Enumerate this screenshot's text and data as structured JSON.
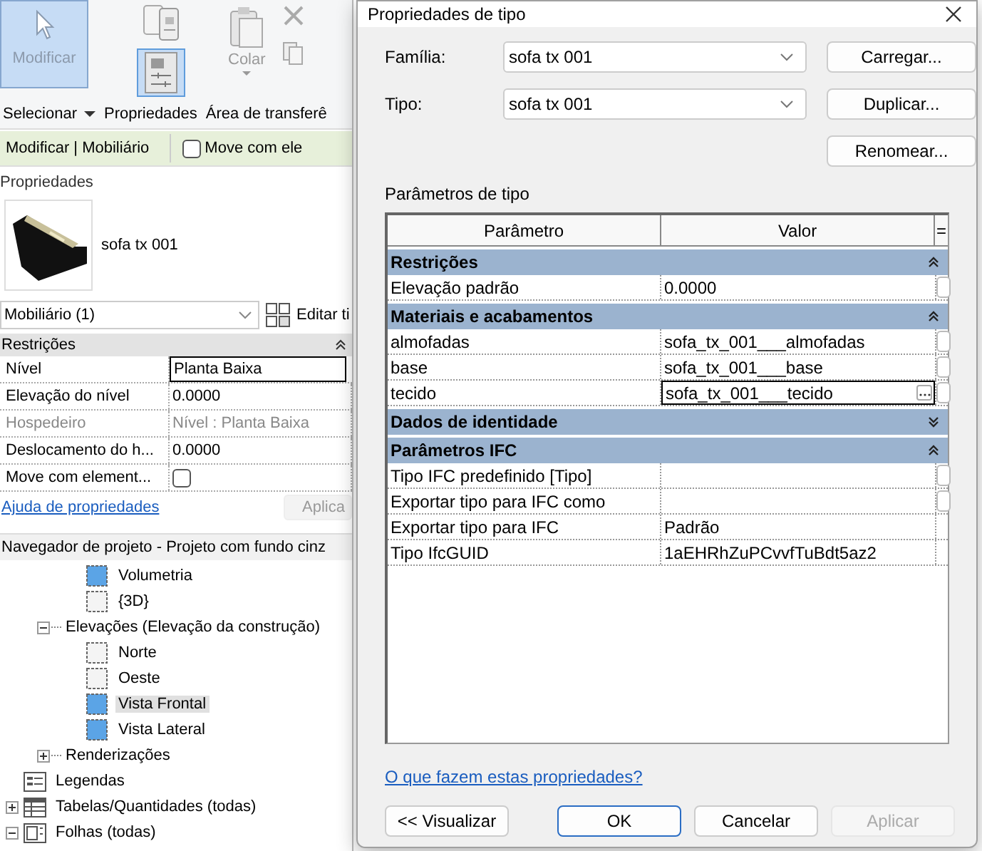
{
  "ribbon": {
    "modify": {
      "label": "Modificar",
      "selected": true
    },
    "properties_tool": {
      "selected": true
    },
    "paste": {
      "label": "Colar",
      "disabled": true
    },
    "panel_titles": [
      {
        "label": "Selecionar",
        "dropdown": true
      },
      {
        "label": "Propriedades",
        "dropdown": false
      },
      {
        "label": "Área de transferê",
        "dropdown": false
      }
    ]
  },
  "context_bar": {
    "title": "Modificar | Mobiliário",
    "option": {
      "label": "Move com ele",
      "checked": false
    }
  },
  "properties": {
    "title": "Propriedades",
    "type_name": "sofa tx 001",
    "selector": "Mobiliário (1)",
    "edit_type": "Editar ti",
    "groups": [
      {
        "name": "Restrições",
        "expanded": true,
        "rows": [
          {
            "name": "Nível",
            "kind": "text",
            "value": "Planta Baixa",
            "selected": true,
            "disabled": false
          },
          {
            "name": "Elevação do nível",
            "kind": "text",
            "value": "0.0000",
            "selected": false,
            "disabled": false
          },
          {
            "name": "Hospedeiro",
            "kind": "text",
            "value": "Nível : Planta Baixa",
            "selected": false,
            "disabled": true
          },
          {
            "name": "Deslocamento do h...",
            "kind": "text",
            "value": "0.0000",
            "selected": false,
            "disabled": false
          },
          {
            "name": "Move com element...",
            "kind": "checkbox",
            "checked": false,
            "selected": false,
            "disabled": false
          }
        ]
      }
    ],
    "help_link": "Ajuda de propriedades",
    "apply": {
      "label": "Aplica",
      "disabled": true
    }
  },
  "browser": {
    "title": "Navegador de projeto - Projeto com fundo cinz",
    "items": [
      {
        "children": [
          {
            "children": [
              {
                "label": "Volumetria",
                "kind": "view",
                "open": true,
                "selected": false
              },
              {
                "label": "{3D}",
                "kind": "view",
                "open": false,
                "selected": false
              }
            ]
          },
          {
            "label": "Elevações (Elevação da construção)",
            "kind": "category",
            "expanded": true,
            "selected": false,
            "children": [
              {
                "label": "Norte",
                "kind": "view",
                "open": false,
                "selected": false
              },
              {
                "label": "Oeste",
                "kind": "view",
                "open": false,
                "selected": false
              },
              {
                "label": "Vista Frontal",
                "kind": "view",
                "open": true,
                "selected": true
              },
              {
                "label": "Vista Lateral",
                "kind": "view",
                "open": true,
                "selected": false
              }
            ]
          },
          {
            "label": "Renderizações",
            "kind": "category",
            "expanded": false,
            "selected": false
          }
        ]
      },
      {
        "label": "Legendas",
        "kind": "legend",
        "selected": false
      },
      {
        "label": "Tabelas/Quantidades (todas)",
        "kind": "schedule",
        "expanded": false,
        "selected": false
      },
      {
        "label": "Folhas (todas)",
        "kind": "sheet",
        "expanded": true,
        "selected": false
      }
    ]
  },
  "dialog": {
    "title": "Propriedades de tipo",
    "fields": [
      {
        "label": "Família:",
        "value": "sofa tx 001"
      },
      {
        "label": "Tipo:",
        "value": "sofa tx 001"
      }
    ],
    "side_buttons": [
      "Carregar...",
      "Duplicar...",
      "Renomear..."
    ],
    "params_label": "Parâmetros de tipo",
    "table": {
      "columns": [
        "Parâmetro",
        "Valor",
        "="
      ],
      "groups": [
        {
          "name": "Restrições",
          "expanded": true,
          "rows": [
            {
              "name": "Elevação padrão",
              "value": "0.0000",
              "editing": false,
              "associable": true
            }
          ]
        },
        {
          "name": "Materiais e acabamentos",
          "expanded": true,
          "rows": [
            {
              "name": "almofadas",
              "value": "sofa_tx_001___almofadas",
              "editing": false,
              "associable": true
            },
            {
              "name": "base",
              "value": "sofa_tx_001___base",
              "editing": false,
              "associable": true
            },
            {
              "name": "tecido",
              "value": "sofa_tx_001___tecido",
              "editing": true,
              "associable": true
            }
          ]
        },
        {
          "name": "Dados de identidade",
          "expanded": false
        },
        {
          "name": "Parâmetros IFC",
          "expanded": true,
          "rows": [
            {
              "name": "Tipo IFC predefinido [Tipo]",
              "editing": false,
              "associable": true
            },
            {
              "name": "Exportar tipo para IFC como",
              "editing": false,
              "associable": true
            },
            {
              "name": "Exportar tipo para IFC",
              "value": "Padrão",
              "editing": false,
              "associable": false
            },
            {
              "name": "Tipo IfcGUID",
              "value": "1aEHRhZuPCvvfTuBdt5az2",
              "editing": false,
              "associable": false
            }
          ]
        }
      ]
    },
    "help_link": "O que fazem estas propriedades?",
    "buttons": [
      {
        "label": "<< Visualizar",
        "default": false,
        "disabled": false
      },
      {
        "label": "OK",
        "default": true,
        "disabled": false
      },
      {
        "label": "Cancelar",
        "default": false,
        "disabled": false
      },
      {
        "label": "Aplicar",
        "default": false,
        "disabled": true
      }
    ]
  }
}
